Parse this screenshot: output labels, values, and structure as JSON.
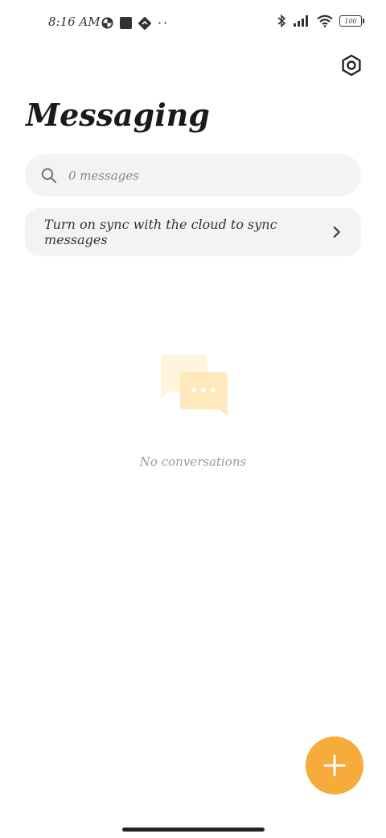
{
  "status_bar": {
    "time": "8:16 AM",
    "battery": "100",
    "icons": [
      "data-saver-icon",
      "square-icon",
      "location-icon",
      "more-dots-icon",
      "bluetooth-icon",
      "signal-icon",
      "wifi-icon",
      "battery-icon"
    ]
  },
  "header": {
    "title": "Messaging",
    "settings_icon": "settings-icon"
  },
  "search": {
    "placeholder": "0 messages",
    "icon": "search-icon"
  },
  "sync_banner": {
    "label": "Turn on sync with the cloud to sync messages",
    "icon": "chevron-right-icon"
  },
  "empty_state": {
    "label": "No conversations",
    "icon": "chat-bubbles-icon"
  },
  "fab": {
    "icon": "plus-icon"
  },
  "colors": {
    "accent": "#f7ab3a",
    "card_bg": "#f3f3f3",
    "illustration_light": "#fff4dc",
    "illustration_mid": "#ffe7b5"
  }
}
